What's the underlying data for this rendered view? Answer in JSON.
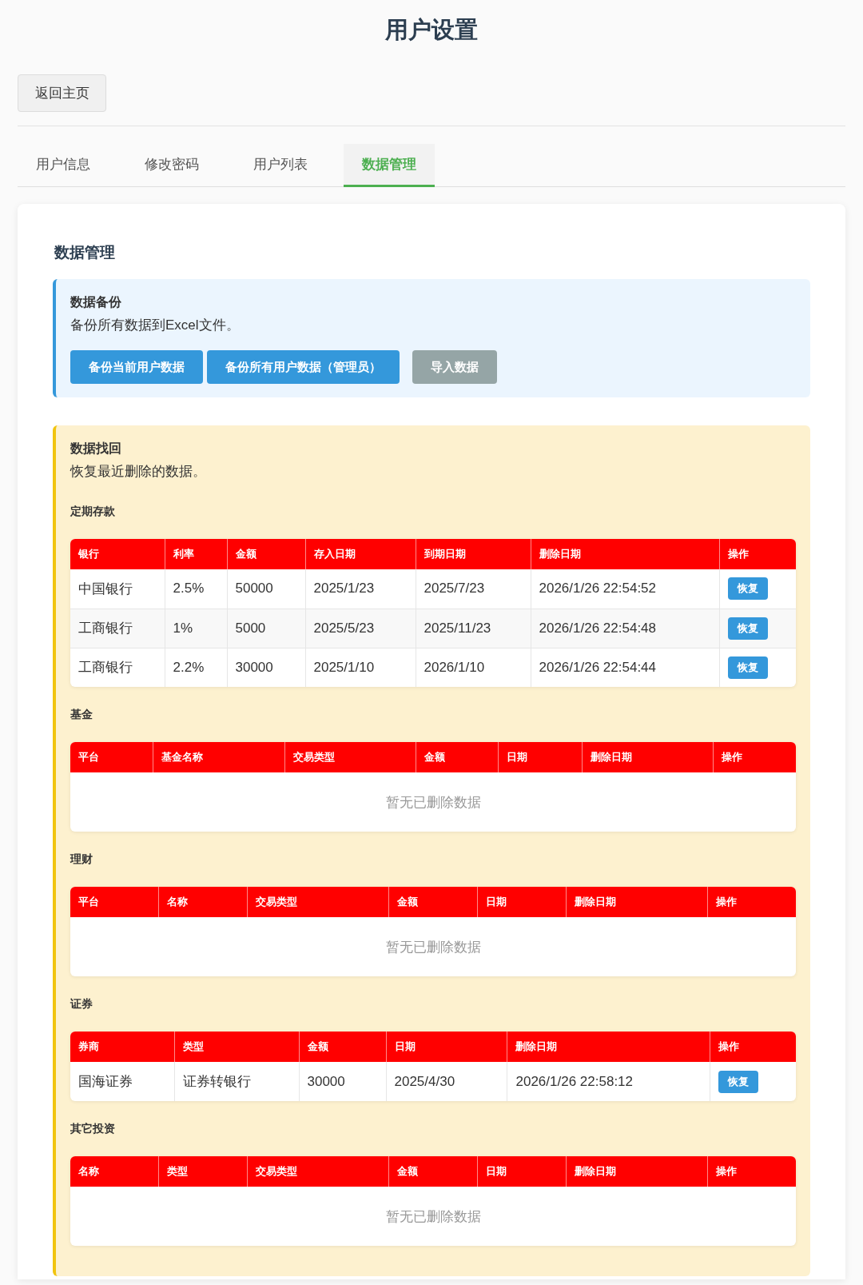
{
  "page": {
    "title": "用户设置"
  },
  "back_button": "返回主页",
  "tabs": [
    {
      "label": "用户信息",
      "selected": false
    },
    {
      "label": "修改密码",
      "selected": false
    },
    {
      "label": "用户列表",
      "selected": false
    },
    {
      "label": "数据管理",
      "selected": true
    }
  ],
  "data_management": {
    "heading": "数据管理",
    "backup": {
      "title": "数据备份",
      "description": "备份所有数据到Excel文件。",
      "buttons": [
        {
          "label": "备份当前用户数据",
          "kind": "primary"
        },
        {
          "label": "备份所有用户数据（管理员）",
          "kind": "primary"
        },
        {
          "label": "导入数据",
          "kind": "secondary"
        }
      ]
    },
    "recovery": {
      "title": "数据找回",
      "description": "恢复最近删除的数据。",
      "sections": [
        {
          "title": "定期存款",
          "columns": [
            "银行",
            "利率",
            "金额",
            "存入日期",
            "到期日期",
            "删除日期",
            "操作"
          ],
          "rows": [
            {
              "cells": [
                "中国银行",
                "2.5%",
                "50000",
                "2025/1/23",
                "2025/7/23",
                "2026/1/26 22:54:52"
              ],
              "action": "恢复"
            },
            {
              "cells": [
                "工商银行",
                "1%",
                "5000",
                "2025/5/23",
                "2025/11/23",
                "2026/1/26 22:54:48"
              ],
              "action": "恢复"
            },
            {
              "cells": [
                "工商银行",
                "2.2%",
                "30000",
                "2025/1/10",
                "2026/1/10",
                "2026/1/26 22:54:44"
              ],
              "action": "恢复"
            }
          ]
        },
        {
          "title": "基金",
          "columns": [
            "平台",
            "基金名称",
            "交易类型",
            "金额",
            "日期",
            "删除日期",
            "操作"
          ],
          "empty_text": "暂无已删除数据"
        },
        {
          "title": "理财",
          "columns": [
            "平台",
            "名称",
            "交易类型",
            "金额",
            "日期",
            "删除日期",
            "操作"
          ],
          "empty_text": "暂无已删除数据"
        },
        {
          "title": "证券",
          "columns": [
            "券商",
            "类型",
            "金额",
            "日期",
            "删除日期",
            "操作"
          ],
          "rows": [
            {
              "cells": [
                "国海证券",
                "证券转银行",
                "30000",
                "2025/4/30",
                "2026/1/26 22:58:12"
              ],
              "action": "恢复"
            }
          ]
        },
        {
          "title": "其它投资",
          "columns": [
            "名称",
            "类型",
            "交易类型",
            "金额",
            "日期",
            "删除日期",
            "操作"
          ],
          "empty_text": "暂无已删除数据"
        }
      ]
    }
  }
}
